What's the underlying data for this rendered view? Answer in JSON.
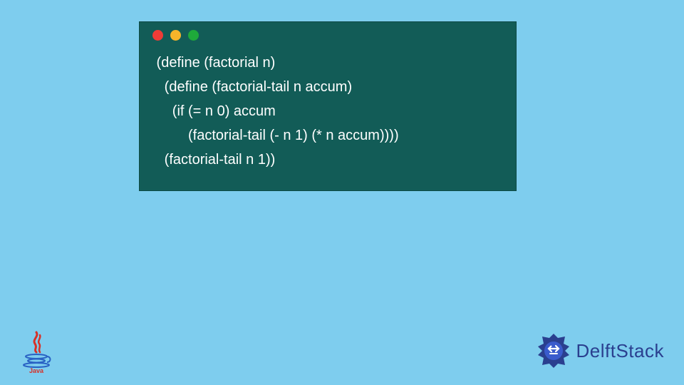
{
  "code": {
    "lines": [
      " (define (factorial n)",
      "   (define (factorial-tail n accum)",
      "     (if (= n 0) accum",
      "         (factorial-tail (- n 1) (* n accum))))",
      "   (factorial-tail n 1))"
    ]
  },
  "window": {
    "dots": [
      "red",
      "yellow",
      "green"
    ]
  },
  "logos": {
    "java": "Java",
    "delftstack": "DelftStack"
  },
  "colors": {
    "background": "#7ecdee",
    "codeBg": "#125c57",
    "codeText": "#ffffff",
    "brandText": "#2a3f8f"
  }
}
